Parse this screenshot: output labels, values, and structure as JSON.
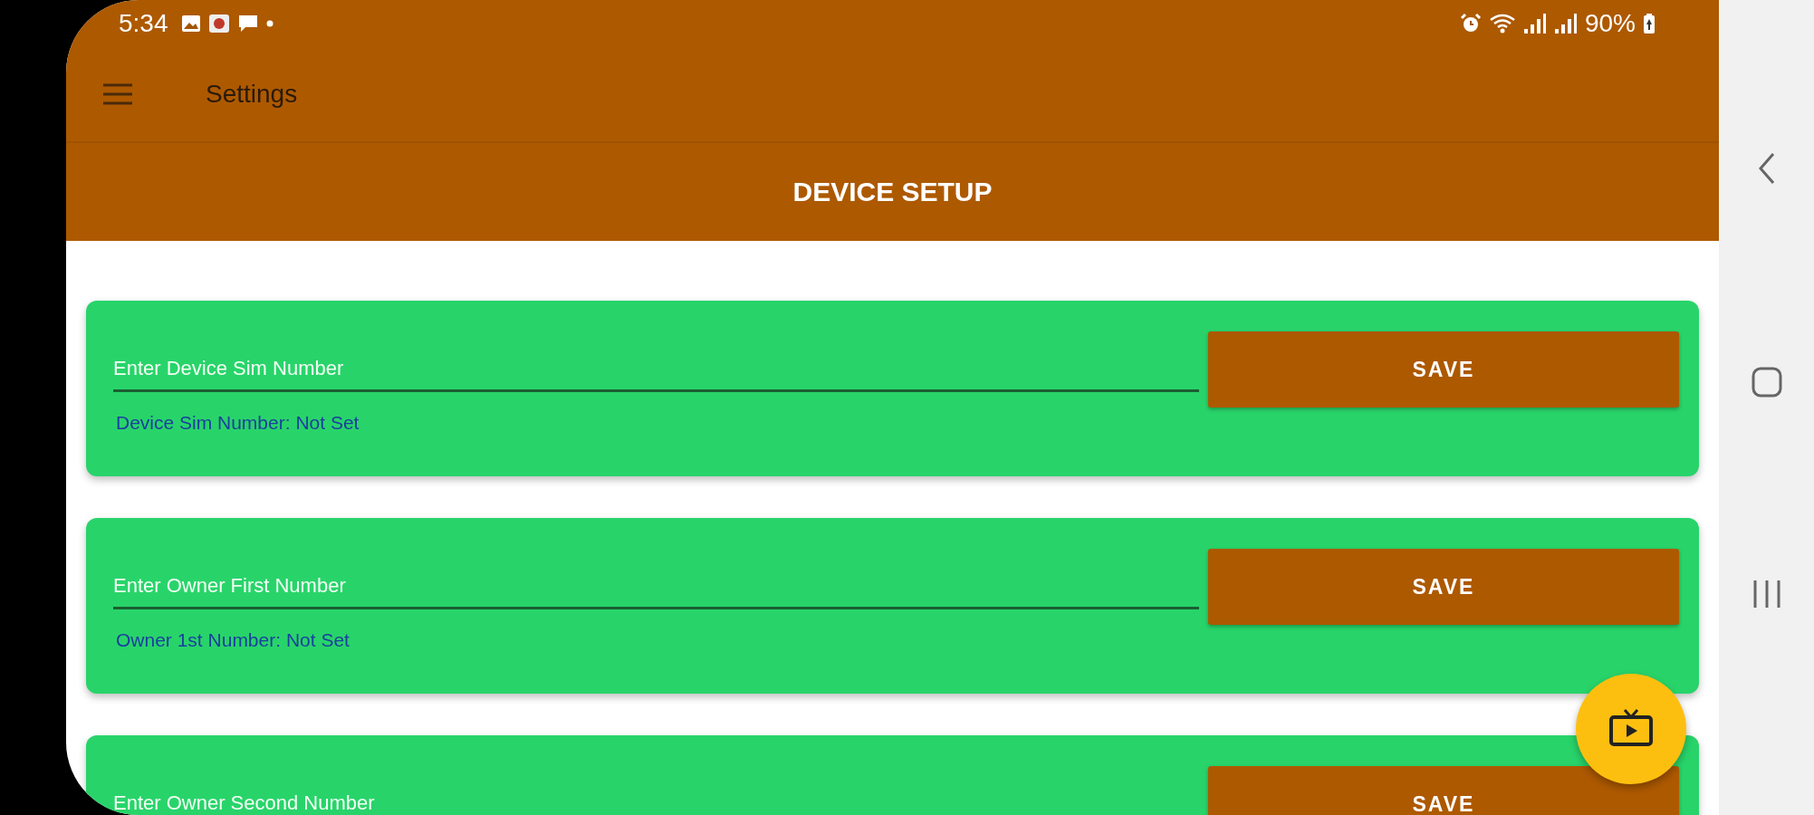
{
  "status_bar": {
    "time": "5:34",
    "battery": "90%"
  },
  "toolbar": {
    "title": "Settings"
  },
  "header": {
    "title": "DEVICE SETUP"
  },
  "cards": [
    {
      "placeholder": "Enter Device Sim Number",
      "button": "SAVE",
      "status": "Device Sim Number: Not Set"
    },
    {
      "placeholder": "Enter Owner First Number",
      "button": "SAVE",
      "status": "Owner 1st Number: Not Set"
    },
    {
      "placeholder": "Enter Owner Second Number",
      "button": "SAVE"
    }
  ]
}
